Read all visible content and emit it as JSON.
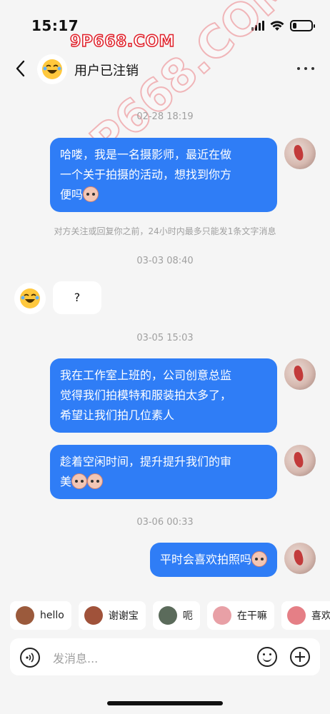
{
  "status_bar": {
    "time": "15:17",
    "battery_level": 0.2
  },
  "watermark": {
    "text": "9P668.COM"
  },
  "header": {
    "title": "用户已注销",
    "back_icon": "chevron-left-icon",
    "more_icon": "more-dots-icon"
  },
  "messages": [
    {
      "type": "timestamp",
      "text": "02-28 18:19"
    },
    {
      "type": "outgoing",
      "lines": [
        "哈喽，我是一名摄影师，最近在做",
        "一个关于拍摄的活动，想找到你方",
        "便吗"
      ],
      "emoji_count": 1
    },
    {
      "type": "system",
      "text": "对方关注或回复你之前，24小时内最多只能发1条文字消息"
    },
    {
      "type": "timestamp",
      "text": "03-03 08:40"
    },
    {
      "type": "incoming",
      "text": "?"
    },
    {
      "type": "timestamp",
      "text": "03-05 15:03"
    },
    {
      "type": "outgoing",
      "lines": [
        "我在工作室上班的，公司创意总监",
        "觉得我们拍模特和服装拍太多了，",
        "希望让我们拍几位素人"
      ],
      "emoji_count": 0
    },
    {
      "type": "outgoing",
      "lines": [
        "趁着空闲时间，提升提升我们的审",
        "美"
      ],
      "emoji_count": 2
    },
    {
      "type": "timestamp",
      "text": "03-06 00:33"
    },
    {
      "type": "outgoing",
      "lines": [
        "平时会喜欢拍照吗"
      ],
      "emoji_count": 1
    }
  ],
  "quick_replies": [
    {
      "label": "hello",
      "icon": "monkey-sticker-icon",
      "color": "#9b5a3c"
    },
    {
      "label": "谢谢宝",
      "icon": "monkey-bow-sticker-icon",
      "color": "#a0523a"
    },
    {
      "label": "呃",
      "icon": "cat-sticker-icon",
      "color": "#5b6b5b"
    },
    {
      "label": "在干嘛",
      "icon": "pig-sticker-icon",
      "color": "#e8a0a6"
    },
    {
      "label": "喜欢",
      "icon": "pig-love-sticker-icon",
      "color": "#e57f86"
    }
  ],
  "input": {
    "placeholder": "发消息..."
  },
  "colors": {
    "outgoing_bubble": "#2f7df6",
    "background": "#f5f5f5"
  }
}
